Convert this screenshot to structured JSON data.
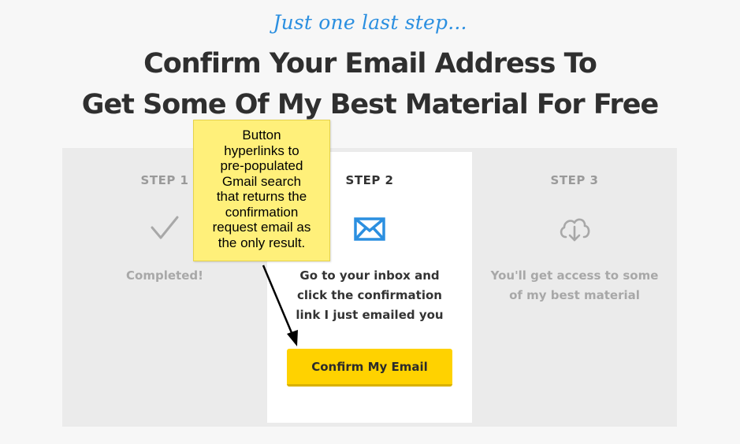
{
  "header": {
    "tagline": "Just one last step...",
    "title_line1": "Confirm Your Email Address To",
    "title_line2": "Get Some Of My Best Material For Free"
  },
  "steps": [
    {
      "label": "STEP 1",
      "icon": "checkmark-icon",
      "text": "Completed!",
      "state": "completed"
    },
    {
      "label": "STEP 2",
      "icon": "envelope-icon",
      "text": "Go to your inbox and click the confirmation link I just emailed you",
      "state": "current",
      "button_label": "Confirm My Email"
    },
    {
      "label": "STEP 3",
      "icon": "cloud-download-icon",
      "text": "You'll get access to some of my best material",
      "state": "upcoming"
    }
  ],
  "annotation": {
    "note_text": "Button\nhyperlinks to\npre-populated\nGmail search\nthat returns the\nconfirmation\nrequest email as\nthe only result."
  },
  "colors": {
    "accent_blue": "#2b8fe0",
    "button_yellow": "#ffd200",
    "note_yellow": "#fff07a",
    "panel_gray": "#ebebeb"
  }
}
